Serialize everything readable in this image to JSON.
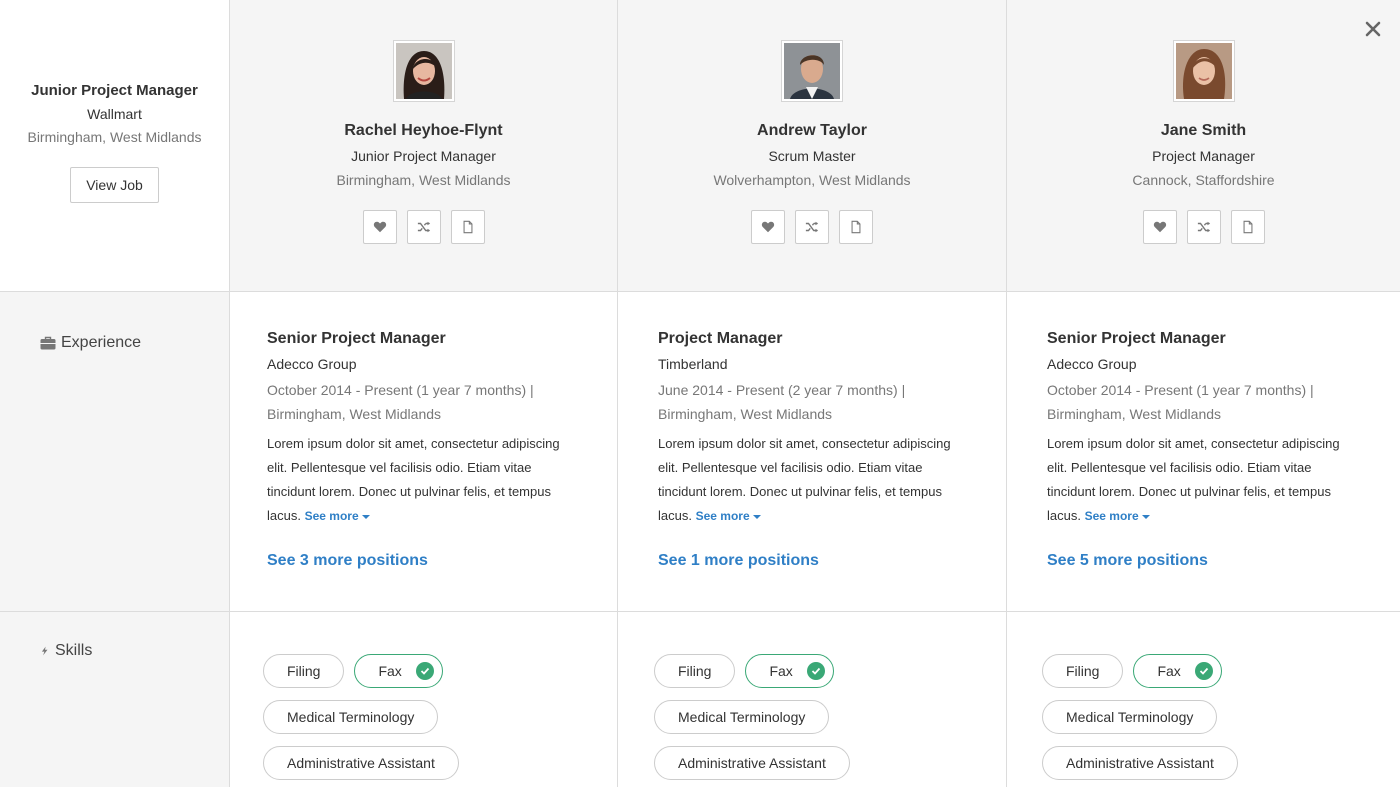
{
  "job": {
    "title": "Junior Project Manager",
    "company": "Wallmart",
    "location": "Birmingham, West Midlands",
    "view_button": "View Job"
  },
  "sections": {
    "experience_label": "Experience",
    "skills_label": "Skills"
  },
  "candidates": [
    {
      "name": "Rachel Heyhoe-Flynt",
      "role": "Junior Project Manager",
      "location": "Birmingham, West Midlands",
      "experience": {
        "title": "Senior Project Manager",
        "company": "Adecco Group",
        "dates": "October 2014 - Present (1 year 7 months) |",
        "location": "Birmingham, West Midlands",
        "description": "Lorem ipsum dolor sit amet, consectetur adipiscing elit. Pellentesque vel facilisis odio. Etiam vitae tincidunt lorem. Donec ut pulvinar felis, et tempus lacus.",
        "see_more": "See more",
        "more_positions": "See 3 more positions"
      },
      "skills": [
        "Filing",
        "Fax",
        "Medical Terminology",
        "Administrative Assistant"
      ]
    },
    {
      "name": "Andrew Taylor",
      "role": "Scrum Master",
      "location": "Wolverhampton, West Midlands",
      "experience": {
        "title": "Project Manager",
        "company": "Timberland",
        "dates": "June 2014 - Present (2 year 7 months) |",
        "location": "Birmingham, West Midlands",
        "description": "Lorem ipsum dolor sit amet, consectetur adipiscing elit. Pellentesque vel facilisis odio. Etiam vitae tincidunt lorem. Donec ut pulvinar felis, et tempus lacus.",
        "see_more": "See more",
        "more_positions": "See 1 more positions"
      },
      "skills": [
        "Filing",
        "Fax",
        "Medical Terminology",
        "Administrative Assistant"
      ]
    },
    {
      "name": "Jane Smith",
      "role": "Project Manager",
      "location": "Cannock, Staffordshire",
      "experience": {
        "title": "Senior Project Manager",
        "company": "Adecco Group",
        "dates": "October 2014 - Present (1 year 7 months) |",
        "location": "Birmingham, West Midlands",
        "description": "Lorem ipsum dolor sit amet, consectetur adipiscing elit. Pellentesque vel facilisis odio. Etiam vitae tincidunt lorem. Donec ut pulvinar felis, et tempus lacus.",
        "see_more": "See more",
        "more_positions": "See 5 more positions"
      },
      "skills": [
        "Filing",
        "Fax",
        "Medical Terminology",
        "Administrative Assistant"
      ]
    }
  ],
  "icons": {
    "close": "close-icon",
    "favorite": "heart-icon",
    "compare": "shuffle-icon",
    "cv": "document-icon",
    "experience": "briefcase-icon",
    "skills": "lightning-icon",
    "verified": "check-icon"
  },
  "colors": {
    "link": "#2f7fc6",
    "verified": "#3aa876",
    "header_bg": "#f5f5f5"
  }
}
